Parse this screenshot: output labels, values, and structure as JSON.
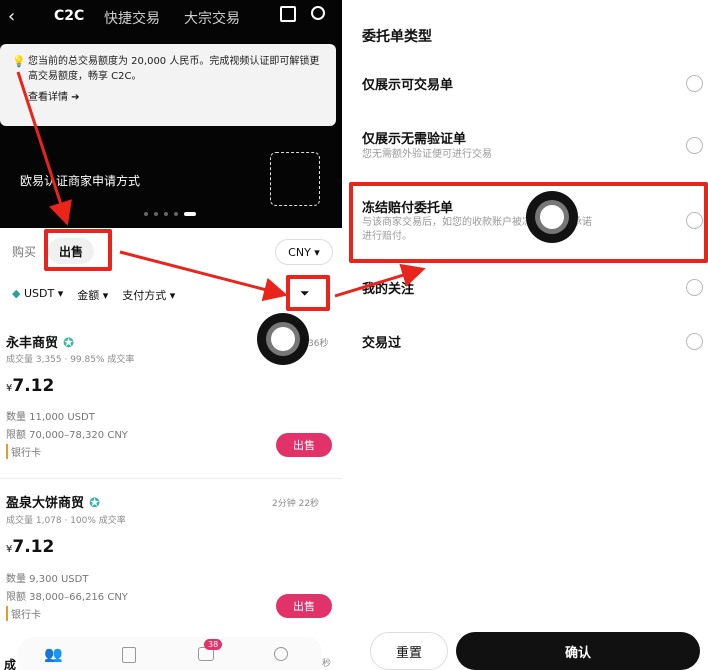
{
  "nav": {
    "tabs": [
      "C2C",
      "快捷交易",
      "大宗交易"
    ]
  },
  "banner": {
    "text": "您当前的总交易额度为 20,000 人民币。完成视频认证即可解锁更高交易额度，畅享 C2C。",
    "link": "查看详情 ➔"
  },
  "promo": {
    "text": "欧易认证商家申请方式"
  },
  "trade": {
    "buy": "购买",
    "sell": "出售",
    "currency": "CNY ▾"
  },
  "filters": {
    "coin": "USDT ▾",
    "amount": "金额 ▾",
    "pay": "支付方式 ▾"
  },
  "offers": [
    {
      "name": "永丰商贸",
      "stats": "成交量 3,355 · 99.85% 成交率",
      "time": "36秒",
      "price": "7.12",
      "qty": "数量 11,000 USDT",
      "limit": "限额 70,000–78,320 CNY",
      "method": "银行卡",
      "btn": "出售"
    },
    {
      "name": "盈泉大饼商贸",
      "stats": "成交量 1,078 · 100% 成交率",
      "time": "2分钟 22秒",
      "price": "7.12",
      "qty": "数量 9,300 USDT",
      "limit": "限额 38,000–66,216 CNY",
      "method": "银行卡",
      "btn": "出售"
    }
  ],
  "bottomnav": {
    "badge": "38",
    "peek": "成",
    "peek_time": "秒"
  },
  "filter_panel": {
    "title": "委托单类型",
    "options": [
      {
        "label": "仅展示可交易单",
        "desc": ""
      },
      {
        "label": "仅展示无需验证单",
        "desc": "您无需额外验证便可进行交易"
      },
      {
        "label": "冻结赔付委托单",
        "desc1": "与该商家交易后，如您的收款账户被冻结，商家承诺",
        "desc2": "进行赔付。"
      },
      {
        "label": "我的关注",
        "desc": ""
      },
      {
        "label": "交易过",
        "desc": ""
      }
    ],
    "reset": "重置",
    "confirm": "确认"
  },
  "colors": {
    "accent": "#e1336a",
    "annotation": "#e8241b",
    "dark": "#050505"
  }
}
